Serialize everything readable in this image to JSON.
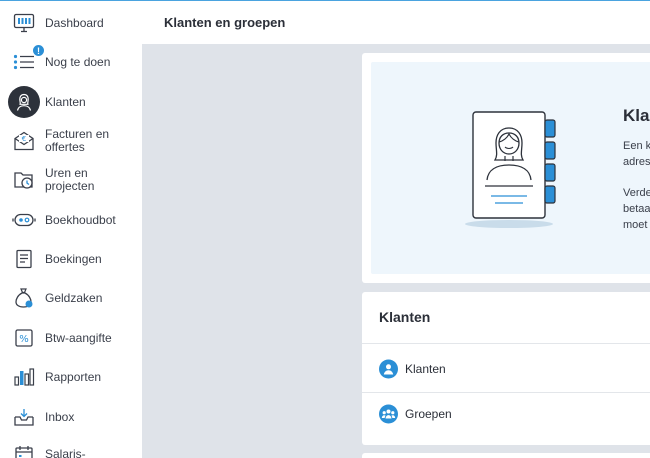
{
  "header": {
    "title": "Klanten en groepen"
  },
  "sidebar": {
    "items": [
      {
        "label": "Dashboard",
        "icon": "dashboard-icon"
      },
      {
        "label": "Nog te doen",
        "icon": "todo-list-icon",
        "badge": "!"
      },
      {
        "label": "Klanten",
        "icon": "customer-icon",
        "active": true
      },
      {
        "label": "Facturen en offertes",
        "icon": "invoice-icon"
      },
      {
        "label": "Uren en projecten",
        "icon": "hours-icon"
      },
      {
        "label": "Boekhoudbot",
        "icon": "bot-icon"
      },
      {
        "label": "Boekingen",
        "icon": "bookings-icon"
      },
      {
        "label": "Geldzaken",
        "icon": "money-bag-icon"
      },
      {
        "label": "Btw-aangifte",
        "icon": "vat-percent-icon"
      },
      {
        "label": "Rapporten",
        "icon": "reports-chart-icon"
      },
      {
        "label": "Inbox",
        "icon": "inbox-icon"
      },
      {
        "label": "Salaris-",
        "icon": "salary-calendar-icon"
      }
    ]
  },
  "intro": {
    "title": "Kla",
    "lines": [
      "Een k",
      "adres",
      "",
      "Verde",
      "betaa",
      "moet"
    ]
  },
  "list": {
    "heading": "Klanten",
    "items": [
      {
        "label": "Klanten",
        "icon": "person-icon"
      },
      {
        "label": "Groepen",
        "icon": "group-icon"
      }
    ]
  },
  "colors": {
    "accent": "#2b8fd6",
    "sidebar_active": "#2d323b",
    "page_bg": "#dfe3e9",
    "intro_bg": "#eef6fc"
  }
}
